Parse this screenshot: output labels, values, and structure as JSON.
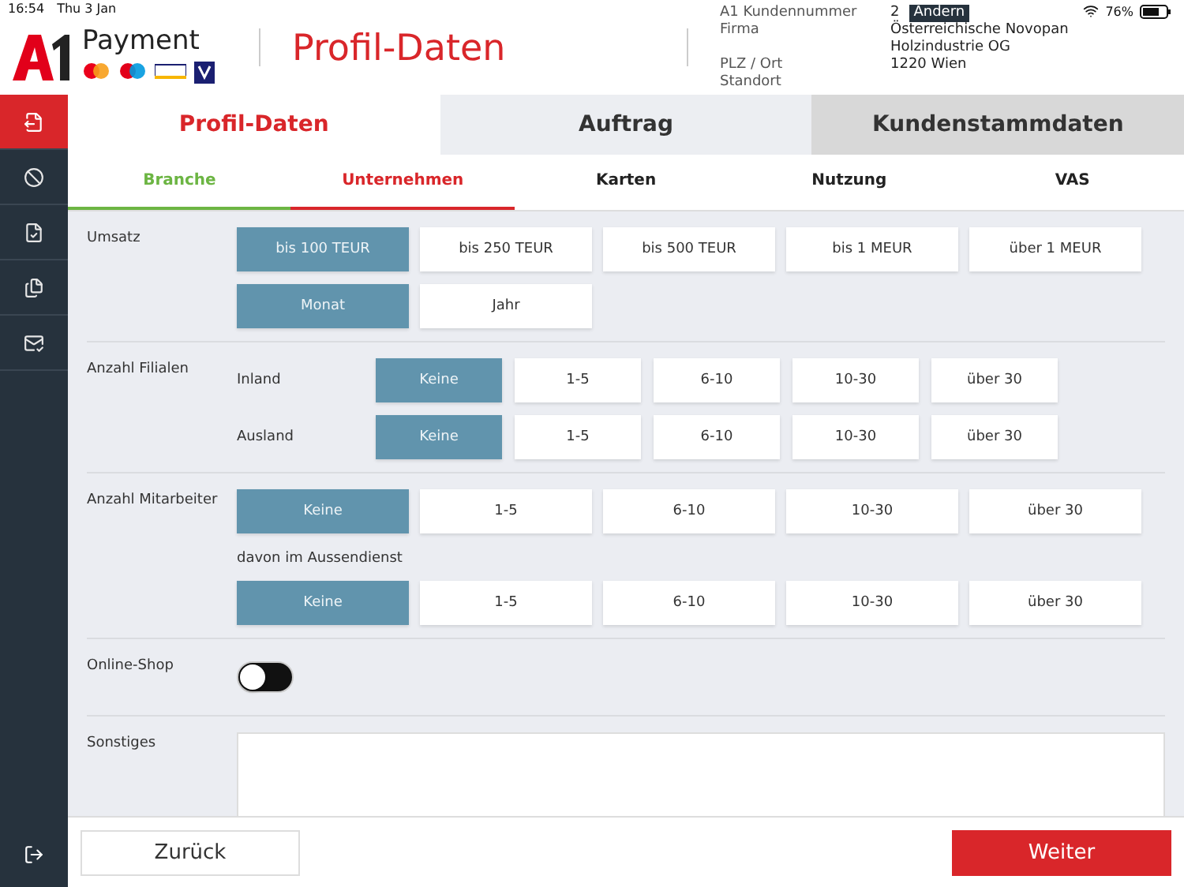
{
  "status_bar": {
    "time": "16:54",
    "date": "Thu 3 Jan",
    "battery": "76%"
  },
  "header": {
    "brand": "Payment",
    "title": "Profil-Daten",
    "info": [
      {
        "label": "A1 Kundennummer",
        "value": "2",
        "action": "Ändern"
      },
      {
        "label": "Firma",
        "value": "Österreichische Novopan Holzindustrie OG"
      },
      {
        "label": "PLZ / Ort",
        "value": "1220 Wien"
      },
      {
        "label": "Standort"
      }
    ]
  },
  "sidebar": {
    "items": [
      {
        "kind": "document",
        "selected": true
      },
      {
        "kind": "blocked",
        "selected": false
      },
      {
        "kind": "checklist",
        "selected": false
      },
      {
        "kind": "documents",
        "selected": false
      },
      {
        "kind": "inbox",
        "selected": false
      }
    ],
    "bottom": {
      "kind": "logout"
    }
  },
  "tabs": [
    {
      "label": "Profil-Daten",
      "selected": true,
      "disabled": false
    },
    {
      "label": "Auftrag",
      "selected": false,
      "disabled": false
    },
    {
      "label": "Kundenstammdaten",
      "selected": false,
      "disabled": true
    }
  ],
  "subtabs": [
    {
      "label": "Branche",
      "selected": false,
      "completed": true
    },
    {
      "label": "Unternehmen",
      "selected": true,
      "completed": false
    },
    {
      "label": "Karten",
      "selected": false,
      "completed": false
    },
    {
      "label": "Nutzung",
      "selected": false,
      "completed": false
    },
    {
      "label": "VAS",
      "selected": false,
      "completed": false
    }
  ],
  "sections": [
    {
      "kind": "options",
      "label": "Umsatz",
      "groups": [
        {
          "options": [
            {
              "label": "bis 100 TEUR",
              "selected": true
            },
            {
              "label": "bis 250 TEUR",
              "selected": false
            },
            {
              "label": "bis 500 TEUR",
              "selected": false
            },
            {
              "label": "bis 1 MEUR",
              "selected": false
            },
            {
              "label": "über 1 MEUR",
              "selected": false
            }
          ]
        },
        {
          "options": [
            {
              "label": "Monat",
              "selected": true
            },
            {
              "label": "Jahr",
              "selected": false
            }
          ]
        }
      ]
    },
    {
      "kind": "labeled",
      "label": "Anzahl Filialen",
      "groups": [
        {
          "label": "Inland",
          "options": [
            {
              "label": "Keine",
              "selected": true
            },
            {
              "label": "1-5",
              "selected": false
            },
            {
              "label": "6-10",
              "selected": false
            },
            {
              "label": "10-30",
              "selected": false
            },
            {
              "label": "über 30",
              "selected": false
            }
          ]
        },
        {
          "label": "Ausland",
          "options": [
            {
              "label": "Keine",
              "selected": true
            },
            {
              "label": "1-5",
              "selected": false
            },
            {
              "label": "6-10",
              "selected": false
            },
            {
              "label": "10-30",
              "selected": false
            },
            {
              "label": "über 30",
              "selected": false
            }
          ]
        }
      ]
    },
    {
      "kind": "options",
      "label": "Anzahl Mitarbeiter",
      "groups": [
        {
          "options": [
            {
              "label": "Keine",
              "selected": true
            },
            {
              "label": "1-5",
              "selected": false
            },
            {
              "label": "6-10",
              "selected": false
            },
            {
              "label": "10-30",
              "selected": false
            },
            {
              "label": "über 30",
              "selected": false
            }
          ]
        },
        {
          "label": "davon im Aussendienst",
          "options": [
            {
              "label": "Keine",
              "selected": true
            },
            {
              "label": "1-5",
              "selected": false
            },
            {
              "label": "6-10",
              "selected": false
            },
            {
              "label": "10-30",
              "selected": false
            },
            {
              "label": "über 30",
              "selected": false
            }
          ]
        }
      ]
    },
    {
      "kind": "toggle",
      "label": "Online-Shop",
      "on": false
    },
    {
      "kind": "textarea",
      "label": "Sonstiges"
    }
  ],
  "footer": {
    "back": "Zurück",
    "next": "Weiter"
  }
}
